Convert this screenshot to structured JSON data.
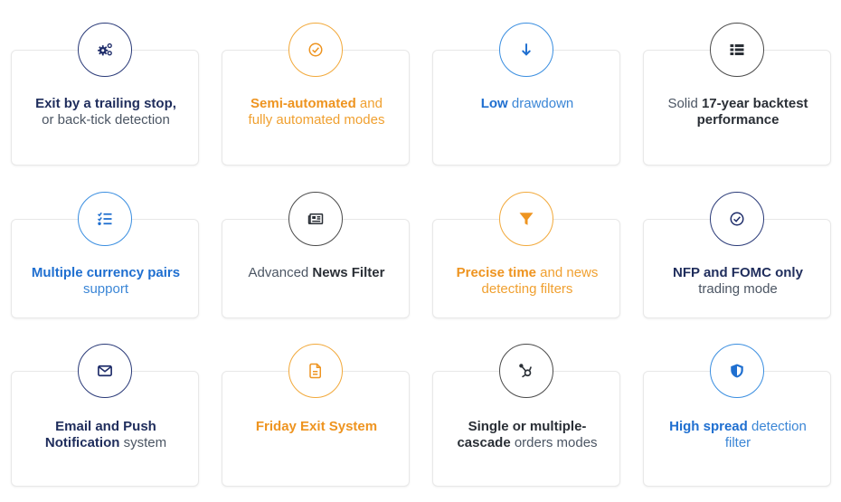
{
  "features": [
    {
      "icon": "gears-icon",
      "theme": "navy",
      "parts": [
        {
          "text": "Exit by a trailing stop,",
          "bold": true
        },
        {
          "text": " or back-tick detection",
          "bold": false
        }
      ]
    },
    {
      "icon": "check-circle-icon",
      "theme": "orange",
      "parts": [
        {
          "text": "Semi-automated",
          "bold": true
        },
        {
          "text": " and fully automated modes",
          "bold": false
        }
      ]
    },
    {
      "icon": "arrow-down-icon",
      "theme": "blue",
      "parts": [
        {
          "text": "Low",
          "bold": true
        },
        {
          "text": " drawdown",
          "bold": false
        }
      ]
    },
    {
      "icon": "list-icon",
      "theme": "dark",
      "parts": [
        {
          "text": "Solid ",
          "bold": false
        },
        {
          "text": "17-year backtest performance",
          "bold": true
        }
      ]
    },
    {
      "icon": "checklist-icon",
      "theme": "blue",
      "parts": [
        {
          "text": "Multiple currency pairs",
          "bold": true
        },
        {
          "text": " support",
          "bold": false
        }
      ]
    },
    {
      "icon": "newspaper-icon",
      "theme": "dark",
      "parts": [
        {
          "text": "Advanced ",
          "bold": false
        },
        {
          "text": "News Filter",
          "bold": true
        }
      ]
    },
    {
      "icon": "filter-icon",
      "theme": "orange",
      "parts": [
        {
          "text": "Precise time",
          "bold": true
        },
        {
          "text": " and news detecting filters",
          "bold": false
        }
      ]
    },
    {
      "icon": "check-circle-icon",
      "theme": "navy",
      "parts": [
        {
          "text": "NFP and FOMC only",
          "bold": true
        },
        {
          "text": " trading mode",
          "bold": false
        }
      ]
    },
    {
      "icon": "envelope-icon",
      "theme": "navy",
      "parts": [
        {
          "text": "Email and Push Notification",
          "bold": true
        },
        {
          "text": " system",
          "bold": false
        }
      ]
    },
    {
      "icon": "document-icon",
      "theme": "orange",
      "parts": [
        {
          "text": "Friday Exit System",
          "bold": true
        }
      ]
    },
    {
      "icon": "hub-icon",
      "theme": "dark",
      "parts": [
        {
          "text": "Single or multiple-cascade",
          "bold": true
        },
        {
          "text": " orders modes",
          "bold": false
        }
      ]
    },
    {
      "icon": "shield-icon",
      "theme": "blue",
      "parts": [
        {
          "text": "High spread",
          "bold": true
        },
        {
          "text": " detection filter",
          "bold": false
        }
      ]
    }
  ],
  "colors": {
    "navy": "#1f2d6a",
    "orange": "#ee9420",
    "blue": "#1f6fd0",
    "dark": "#2a2f36"
  }
}
